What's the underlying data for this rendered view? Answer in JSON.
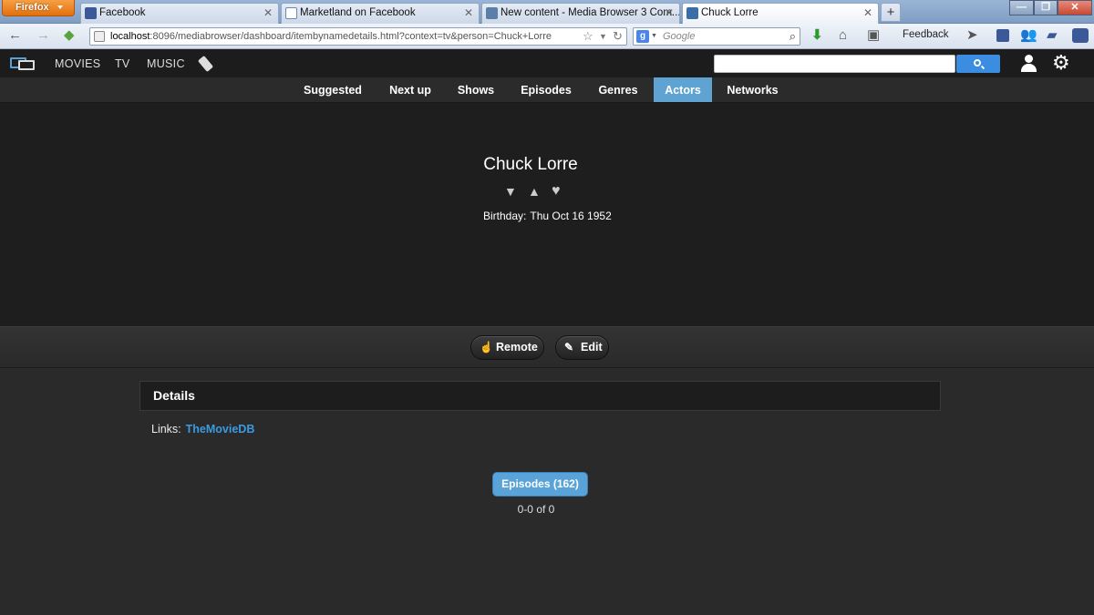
{
  "browser": {
    "app_button": "Firefox",
    "tabs": [
      {
        "title": "Facebook"
      },
      {
        "title": "Marketland on Facebook"
      },
      {
        "title": "New content - Media Browser 3 Com..."
      },
      {
        "title": "Chuck Lorre"
      }
    ],
    "new_tab": "+",
    "url_host": "localhost",
    "url_rest": ":8096/mediabrowser/dashboard/itembynamedetails.html?context=tv&person=Chuck+Lorre",
    "search_engine_letter": "g",
    "search_placeholder": "Google",
    "feedback_label": "Feedback"
  },
  "header": {
    "nav": [
      "MOVIES",
      "TV",
      "MUSIC"
    ],
    "search_value": ""
  },
  "subnav": {
    "tabs": [
      "Suggested",
      "Next up",
      "Shows",
      "Episodes",
      "Genres",
      "Actors",
      "Networks"
    ],
    "active": "Actors"
  },
  "person": {
    "name": "Chuck Lorre",
    "birthday_label": "Birthday:",
    "birthday_value": "Thu Oct 16 1952"
  },
  "actions": {
    "remote_label": "Remote",
    "edit_label": "Edit"
  },
  "details": {
    "heading": "Details",
    "links_label": "Links:",
    "links": [
      "TheMovieDB"
    ]
  },
  "episodes": {
    "button_label": "Episodes (162)",
    "pager_text": "0-0 of 0"
  },
  "colors": {
    "accent": "#5fa3d3",
    "link": "#3b9be0",
    "header_bg": "#1c1c1c",
    "hero_bg": "#1e1e1e"
  }
}
